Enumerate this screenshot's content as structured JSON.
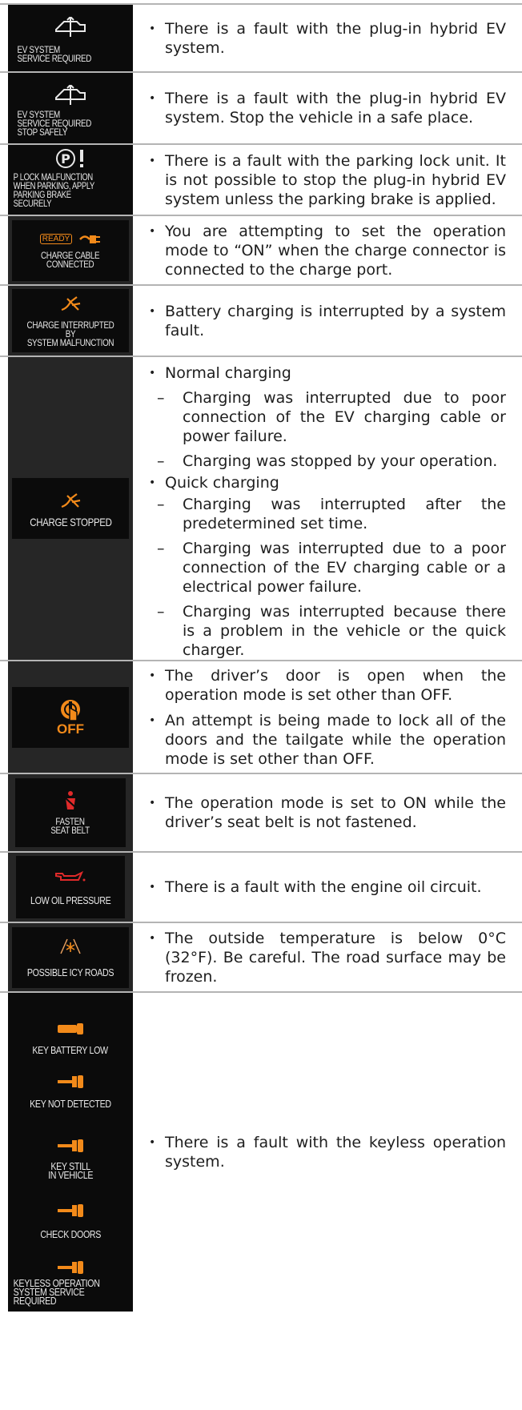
{
  "rows": [
    {
      "icon": "ev-system-warning-icon",
      "caption": "EV SYSTEM\nSERVICE REQUIRED",
      "bullets": [
        "There is a fault with the plug-in hybrid EV system."
      ]
    },
    {
      "icon": "ev-system-warning-icon",
      "caption": "EV SYSTEM\nSERVICE REQUIRED\nSTOP SAFELY",
      "bullets": [
        "There is a fault with the plug-in hybrid EV system. Stop the vehicle in a safe place."
      ]
    },
    {
      "icon": "parking-lock-warning-icon",
      "caption": "P LOCK MALFUNCTION\nWHEN PARKING, APPLY\nPARKING BRAKE SECURELY",
      "bullets": [
        "There is a fault with the parking lock unit. It is not possible to stop the plug-in hybrid EV system unless the parking brake is applied."
      ]
    },
    {
      "icon": "ready-charge-plug-icon",
      "icon_label": "READY",
      "caption": "CHARGE CABLE\nCONNECTED",
      "bullets": [
        "You are attempting to set the operation mode to “ON” when the charge connector is connected to the charge port."
      ]
    },
    {
      "icon": "charge-interrupted-icon",
      "caption": "CHARGE INTERRUPTED BY\nSYSTEM MALFUNCTION",
      "bullets": [
        "Battery charging is interrupted by a system fault."
      ]
    },
    {
      "icon": "charge-interrupted-icon",
      "caption": "CHARGE STOPPED",
      "normal": {
        "heading": "Normal charging",
        "items": [
          "Charging was interrupted due to poor connection of the EV charging cable or power failure.",
          "Charging was stopped by your operation."
        ]
      },
      "quick": {
        "heading": "Quick charging",
        "items": [
          "Charging was interrupted after the predetermined set time.",
          "Charging was interrupted due to a poor connection of the EV charging cable or a electrical power failure.",
          "Charging was interrupted because there is a problem in the vehicle or the quick charger."
        ]
      }
    },
    {
      "icon": "power-off-hand-icon",
      "icon_label": "OFF",
      "bullets": [
        "The driver’s door is open when the operation mode is set other than OFF.",
        "An attempt is being made to lock all of the doors and the tailgate while the operation mode is set other than OFF."
      ]
    },
    {
      "icon": "seat-belt-icon",
      "caption": "FASTEN\nSEAT BELT",
      "bullets": [
        "The operation mode is set to ON while the driver’s seat belt is not fastened."
      ]
    },
    {
      "icon": "oil-can-icon",
      "caption": "LOW OIL PRESSURE",
      "bullets": [
        "There is a fault with the engine oil circuit."
      ]
    },
    {
      "icon": "icy-road-icon",
      "caption": "POSSIBLE ICY ROADS",
      "bullets": [
        "The outside temperature is below 0°C (32°F). Be careful. The road surface may be frozen."
      ]
    },
    {
      "icons": [
        {
          "icon": "key-battery-icon",
          "caption": "KEY BATTERY LOW"
        },
        {
          "icon": "key-fob-icon",
          "caption": "KEY NOT DETECTED"
        },
        {
          "icon": "key-fob-icon",
          "caption": "KEY STILL\nIN VEHICLE"
        },
        {
          "icon": "key-fob-icon",
          "caption": "CHECK DOORS"
        },
        {
          "icon": "key-fob-icon",
          "caption": "KEYLESS OPERATION\nSYSTEM SERVICE\nREQUIRED"
        }
      ],
      "bullets": [
        "There is a fault with the keyless operation system."
      ]
    }
  ],
  "colors": {
    "warning": "#f28a1a",
    "alert_red": "#e02a2a",
    "caption": "#e8e8e8",
    "panel": "#0b0b0b",
    "cell": "#262626",
    "rule": "#b4b4b4"
  }
}
